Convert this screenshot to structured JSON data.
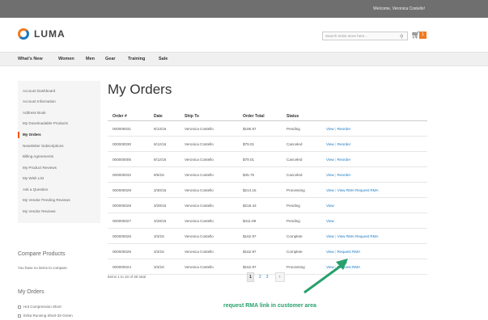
{
  "topbar": {
    "welcome": "Welcome, Veronica Costello!",
    "account": "Veronica Costello ⌄"
  },
  "header": {
    "logo": "LUMA",
    "search_placeholder": "Search entire store here...",
    "cart_count": "1"
  },
  "nav": [
    "What's New",
    "Women",
    "Men",
    "Gear",
    "Training",
    "Sale"
  ],
  "sidebar": {
    "items": [
      "Account Dashboard",
      "Account Information",
      "Address Book",
      "My Downloadable Products",
      "My Orders",
      "Newsletter Subscriptions",
      "Billing Agreements",
      "My Product Reviews",
      "My Wish List",
      "Ask a Question",
      "My Vendor Pending Reviews",
      "My Vendor Reviews"
    ],
    "active_index": 4
  },
  "compare": {
    "title": "Compare Products",
    "text": "You have no items to compare."
  },
  "my_orders_block": {
    "title": "My Orders",
    "items": [
      "Hot Compression Short",
      "Erika Running Short-32-Green"
    ]
  },
  "page_title": "My Orders",
  "table": {
    "headers": [
      "Order #",
      "Date",
      "Ship To",
      "Order Total",
      "Status"
    ],
    "rows": [
      {
        "order": "000000031",
        "date": "9/13/16",
        "ship_to": "Veronica Costello",
        "total": "$185.87",
        "status": "Pending",
        "actions": [
          "View",
          "Reorder"
        ]
      },
      {
        "order": "000000030",
        "date": "9/12/16",
        "ship_to": "Veronica Costello",
        "total": "$79.01",
        "status": "Canceled",
        "actions": [
          "View",
          "Reorder"
        ]
      },
      {
        "order": "000000005",
        "date": "9/12/16",
        "ship_to": "Veronica Costello",
        "total": "$79.01",
        "status": "Canceled",
        "actions": [
          "View",
          "Reorder"
        ]
      },
      {
        "order": "000000032",
        "date": "9/6/16",
        "ship_to": "Veronica Costello",
        "total": "$45.75",
        "status": "Canceled",
        "actions": [
          "View",
          "Reorder"
        ]
      },
      {
        "order": "000000029",
        "date": "3/30/16",
        "ship_to": "Veronica Costello",
        "total": "$214.15",
        "status": "Processing",
        "actions": [
          "View",
          "View RMA Request RMA"
        ]
      },
      {
        "order": "000000028",
        "date": "3/29/16",
        "ship_to": "Veronica Costello",
        "total": "$218.43",
        "status": "Pending",
        "actions": [
          "View"
        ]
      },
      {
        "order": "000000027",
        "date": "3/28/16",
        "ship_to": "Veronica Costello",
        "total": "$411.99",
        "status": "Pending",
        "actions": [
          "View"
        ]
      },
      {
        "order": "000000026",
        "date": "3/3/16",
        "ship_to": "Veronica Costello",
        "total": "$162.97",
        "status": "Complete",
        "actions": [
          "View",
          "View RMA Request RMA"
        ]
      },
      {
        "order": "000000025",
        "date": "3/3/16",
        "ship_to": "Veronica Costello",
        "total": "$162.97",
        "status": "Complete",
        "actions": [
          "View",
          "Request RMA"
        ]
      },
      {
        "order": "000000024",
        "date": "3/3/16",
        "ship_to": "Veronica Costello",
        "total": "$162.97",
        "status": "Processing",
        "actions": [
          "View",
          "Request RMA"
        ]
      }
    ]
  },
  "pager": {
    "label": "Items 1 to 10 of 30 total",
    "current": "1",
    "pages": [
      "2",
      "3"
    ],
    "next": "›"
  },
  "annotation": "request RMA link in customer area",
  "colors": {
    "link": "#1979c3",
    "annotation": "#27a06b",
    "accent": "#f07a20"
  }
}
